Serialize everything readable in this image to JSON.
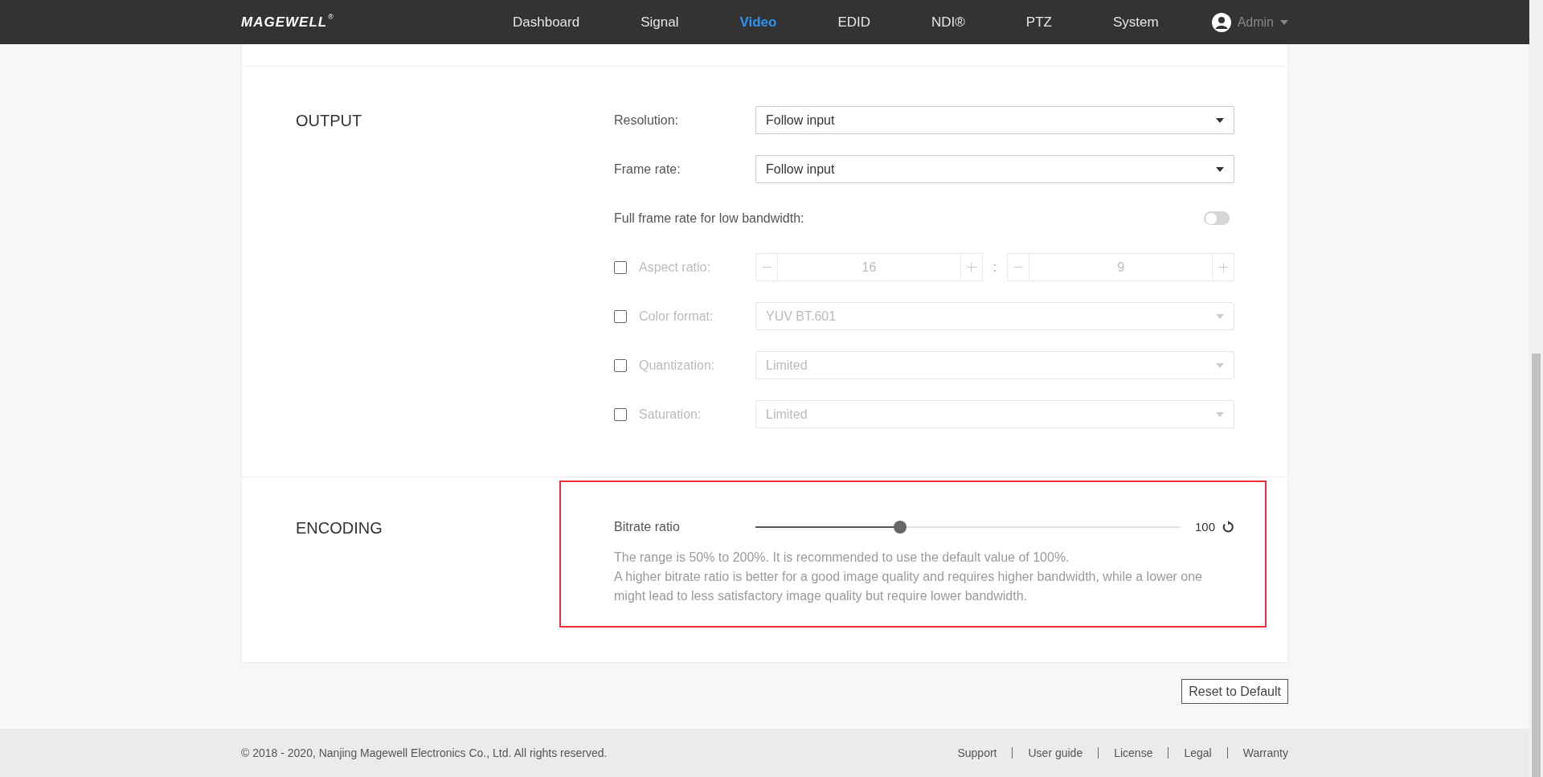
{
  "header": {
    "logo": "MAGEWELL",
    "logo_mark": "®",
    "nav": [
      {
        "label": "Dashboard",
        "selected": false
      },
      {
        "label": "Signal",
        "selected": false
      },
      {
        "label": "Video",
        "selected": true
      },
      {
        "label": "EDID",
        "selected": false
      },
      {
        "label": "NDI®",
        "selected": false
      },
      {
        "label": "PTZ",
        "selected": false
      },
      {
        "label": "System",
        "selected": false
      }
    ],
    "user": "Admin"
  },
  "output": {
    "title": "OUTPUT",
    "fields": [
      {
        "kind": "select",
        "label": "Resolution:",
        "value": "Follow input",
        "disabled": false
      },
      {
        "kind": "select",
        "label": "Frame rate:",
        "value": "Follow input",
        "disabled": false
      },
      {
        "kind": "toggle",
        "label": "Full frame rate for low bandwidth:",
        "on": false
      },
      {
        "kind": "ratio",
        "label": "Aspect ratio:",
        "checked": false,
        "disabled": true,
        "values": [
          "16",
          "9"
        ],
        "separator": ":"
      },
      {
        "kind": "select",
        "label": "Color format:",
        "checked": false,
        "value": "YUV BT.601",
        "disabled": true
      },
      {
        "kind": "select",
        "label": "Quantization:",
        "checked": false,
        "value": "Limited",
        "disabled": true
      },
      {
        "kind": "select",
        "label": "Saturation:",
        "checked": false,
        "value": "Limited",
        "disabled": true
      }
    ]
  },
  "encoding": {
    "title": "ENCODING",
    "highlighted": true,
    "label": "Bitrate ratio",
    "level": 0.34,
    "reading": "100",
    "notes": [
      "The range is 50% to 200%. It is recommended to use the default value of 100%.",
      "A higher bitrate ratio is better for a good image quality and requires higher bandwidth, while a lower one might lead to less satisfactory image quality but require lower bandwidth."
    ]
  },
  "reset_button": "Reset to Default",
  "footer": {
    "copyright": "© 2018 - 2020, Nanjing Magewell Electronics Co., Ltd. All rights reserved.",
    "links": [
      "Support",
      "User guide",
      "License",
      "Legal",
      "Warranty"
    ]
  }
}
